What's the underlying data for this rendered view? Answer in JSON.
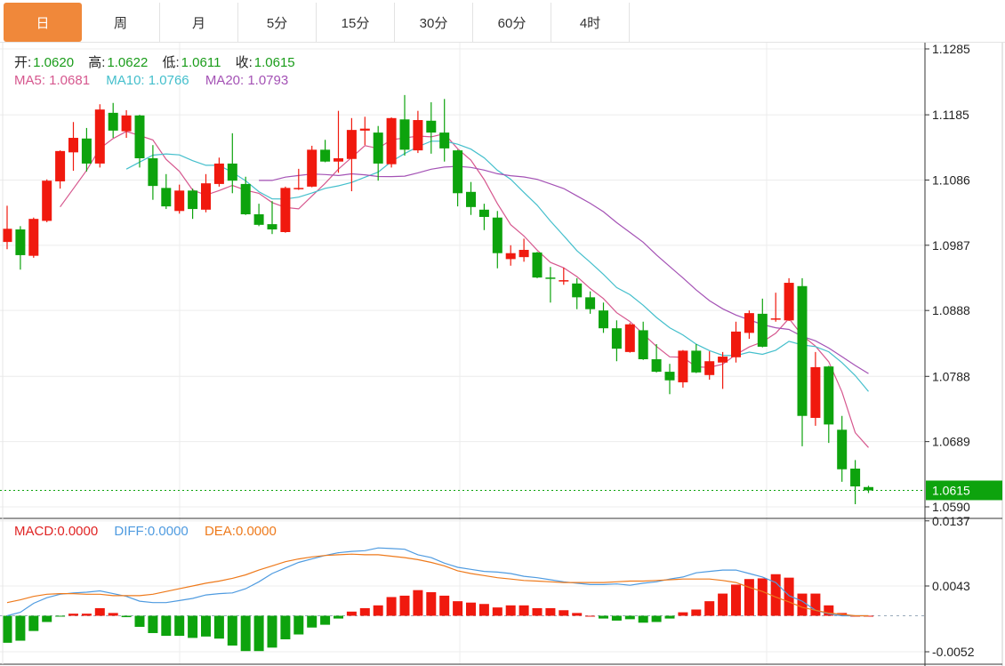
{
  "tabs": [
    {
      "label": "日",
      "active": true
    },
    {
      "label": "周"
    },
    {
      "label": "月"
    },
    {
      "label": "5分"
    },
    {
      "label": "15分"
    },
    {
      "label": "30分"
    },
    {
      "label": "60分"
    },
    {
      "label": "4时"
    }
  ],
  "ohlc_legend": {
    "open_label": "开:",
    "open": "1.0620",
    "high_label": "高:",
    "high": "1.0622",
    "low_label": "低:",
    "low": "1.0611",
    "close_label": "收:",
    "close": "1.0615"
  },
  "ma_legend": {
    "ma5": "MA5: 1.0681",
    "ma10": "MA10: 1.0766",
    "ma20": "MA20: 1.0793"
  },
  "macd_legend": {
    "macd": "MACD:0.0000",
    "diff": "DIFF:0.0000",
    "dea": "DEA:0.0000"
  },
  "colors": {
    "up": "#F0190E",
    "down": "#0DA30D",
    "ma5": "#D6578E",
    "ma10": "#44BFCC",
    "ma20": "#A452B5",
    "diff": "#4F9BE0",
    "dea": "#EE7A1C",
    "active_tab": "#F0883A",
    "price_tag": "#0DA30D"
  },
  "chart_data": [
    {
      "type": "candlestick",
      "price_axis_ticks": [
        "1.1285",
        "1.1185",
        "1.1086",
        "1.0987",
        "1.0888",
        "1.0788",
        "1.0689",
        "1.0590"
      ],
      "ylim": [
        1.059,
        1.1285
      ],
      "current_price": "1.0615",
      "moving_averages": [
        5,
        10,
        20
      ],
      "ohlc": [
        [
          1.0992,
          1.1047,
          1.0981,
          1.1012
        ],
        [
          1.1011,
          1.1016,
          1.095,
          1.0972
        ],
        [
          1.0971,
          1.1029,
          1.0968,
          1.1027
        ],
        [
          1.1024,
          1.1087,
          1.1022,
          1.1085
        ],
        [
          1.1084,
          1.1131,
          1.1073,
          1.113
        ],
        [
          1.1128,
          1.1174,
          1.11,
          1.115
        ],
        [
          1.1149,
          1.1165,
          1.1099,
          1.1111
        ],
        [
          1.1111,
          1.1201,
          1.1105,
          1.1193
        ],
        [
          1.1188,
          1.1203,
          1.115,
          1.1161
        ],
        [
          1.116,
          1.1192,
          1.115,
          1.1184
        ],
        [
          1.1184,
          1.1185,
          1.1105,
          1.1119
        ],
        [
          1.1119,
          1.1139,
          1.1056,
          1.1077
        ],
        [
          1.1074,
          1.1095,
          1.1042,
          1.1046
        ],
        [
          1.1039,
          1.1079,
          1.1035,
          1.107
        ],
        [
          1.107,
          1.1073,
          1.1027,
          1.1042
        ],
        [
          1.1041,
          1.1095,
          1.1037,
          1.1081
        ],
        [
          1.108,
          1.112,
          1.1076,
          1.1111
        ],
        [
          1.1111,
          1.1157,
          1.1066,
          1.1085
        ],
        [
          1.108,
          1.1091,
          1.1033,
          1.1034
        ],
        [
          1.1034,
          1.105,
          1.1016,
          1.1018
        ],
        [
          1.1019,
          1.1054,
          1.1004,
          1.1011
        ],
        [
          1.1007,
          1.1076,
          1.1006,
          1.1074
        ],
        [
          1.1072,
          1.1103,
          1.1071,
          1.1074
        ],
        [
          1.1076,
          1.1138,
          1.1075,
          1.1132
        ],
        [
          1.1132,
          1.1147,
          1.1113,
          1.1114
        ],
        [
          1.1114,
          1.1191,
          1.1097,
          1.1119
        ],
        [
          1.1118,
          1.118,
          1.1069,
          1.1162
        ],
        [
          1.1161,
          1.1182,
          1.1139,
          1.1164
        ],
        [
          1.1158,
          1.1168,
          1.1085,
          1.1111
        ],
        [
          1.111,
          1.1181,
          1.1105,
          1.118
        ],
        [
          1.1178,
          1.1215,
          1.1123,
          1.1132
        ],
        [
          1.1131,
          1.1191,
          1.1127,
          1.1177
        ],
        [
          1.1176,
          1.1204,
          1.1126,
          1.1158
        ],
        [
          1.1158,
          1.1209,
          1.1114,
          1.1134
        ],
        [
          1.1131,
          1.1132,
          1.1046,
          1.1066
        ],
        [
          1.1068,
          1.1083,
          1.1033,
          1.1045
        ],
        [
          1.1041,
          1.105,
          1.101,
          1.103
        ],
        [
          1.1029,
          1.1039,
          1.0952,
          1.0975
        ],
        [
          1.0966,
          1.0987,
          1.0956,
          1.0975
        ],
        [
          1.0969,
          1.0997,
          1.0962,
          1.098
        ],
        [
          1.0976,
          1.0977,
          1.0937,
          1.0938
        ],
        [
          1.0938,
          1.0954,
          1.09,
          1.0937
        ],
        [
          1.0933,
          1.0953,
          1.0927,
          1.0934
        ],
        [
          1.0929,
          1.0937,
          1.089,
          1.0908
        ],
        [
          1.0908,
          1.0917,
          1.0883,
          1.089
        ],
        [
          1.0888,
          1.09,
          1.0854,
          1.0861
        ],
        [
          1.0861,
          1.0873,
          1.0811,
          1.083
        ],
        [
          1.0825,
          1.0869,
          1.0824,
          1.0867
        ],
        [
          1.0858,
          1.0871,
          1.0813,
          1.0814
        ],
        [
          1.0814,
          1.0837,
          1.0794,
          1.0795
        ],
        [
          1.0795,
          1.0807,
          1.0761,
          1.0782
        ],
        [
          1.0779,
          1.0828,
          1.0771,
          1.0827
        ],
        [
          1.0827,
          1.0837,
          1.0793,
          1.0794
        ],
        [
          1.079,
          1.0826,
          1.0783,
          1.0811
        ],
        [
          1.0809,
          1.0825,
          1.0769,
          1.0818
        ],
        [
          1.0817,
          1.0871,
          1.0809,
          1.0856
        ],
        [
          1.0854,
          1.0888,
          1.0845,
          1.0884
        ],
        [
          1.0883,
          1.0906,
          1.0832,
          1.0833
        ],
        [
          1.0875,
          1.0915,
          1.0871,
          1.0876
        ],
        [
          1.0873,
          1.0937,
          1.0872,
          1.093
        ],
        [
          1.0925,
          1.0937,
          1.0682,
          1.0728
        ],
        [
          1.0725,
          1.0825,
          1.0713,
          1.0802
        ],
        [
          1.0803,
          1.0804,
          1.0687,
          1.0715
        ],
        [
          1.0707,
          1.0728,
          1.0628,
          1.0647
        ],
        [
          1.0648,
          1.0661,
          1.0594,
          1.0621
        ],
        [
          1.062,
          1.0622,
          1.0611,
          1.0615
        ]
      ]
    },
    {
      "type": "bar+line",
      "axis_ticks": [
        "0.0137",
        "0.0043",
        "-0.0052"
      ],
      "ylim": [
        -0.0052,
        0.0137
      ],
      "macd_hist": [
        -0.0039,
        -0.0036,
        -0.0022,
        -0.0009,
        -0.0001,
        0.0003,
        0.0003,
        0.0011,
        0.0004,
        -0.0002,
        -0.0016,
        -0.0025,
        -0.0029,
        -0.0029,
        -0.0032,
        -0.003,
        -0.0033,
        -0.0043,
        -0.0051,
        -0.0051,
        -0.0046,
        -0.0034,
        -0.0027,
        -0.0017,
        -0.0013,
        -0.0004,
        0.0006,
        0.0011,
        0.0015,
        0.0027,
        0.0029,
        0.0037,
        0.0034,
        0.0029,
        0.0021,
        0.0019,
        0.0017,
        0.0012,
        0.0015,
        0.0015,
        0.0011,
        0.0011,
        0.0008,
        0.0004,
        0.0,
        -0.0004,
        -0.0007,
        -0.0005,
        -0.001,
        -0.0009,
        -0.0004,
        0.0005,
        0.0009,
        0.0021,
        0.0032,
        0.0045,
        0.0053,
        0.0054,
        0.006,
        0.0055,
        0.0032,
        0.0032,
        0.0015,
        0.0004,
        0.0,
        0.0
      ],
      "diff": [
        0.0,
        0.0005,
        0.0018,
        0.0026,
        0.0031,
        0.0033,
        0.0034,
        0.0036,
        0.0032,
        0.0028,
        0.0021,
        0.0019,
        0.0019,
        0.0022,
        0.0025,
        0.003,
        0.0032,
        0.0033,
        0.0039,
        0.0049,
        0.0061,
        0.0069,
        0.0077,
        0.0082,
        0.0087,
        0.0091,
        0.0093,
        0.0094,
        0.0098,
        0.0097,
        0.0096,
        0.0088,
        0.0084,
        0.0076,
        0.007,
        0.0067,
        0.0064,
        0.0063,
        0.0061,
        0.0057,
        0.0055,
        0.0052,
        0.0049,
        0.0047,
        0.0045,
        0.0045,
        0.0046,
        0.0044,
        0.0047,
        0.0049,
        0.0053,
        0.0056,
        0.0062,
        0.0064,
        0.0066,
        0.0066,
        0.0061,
        0.0056,
        0.0048,
        0.0029,
        0.0021,
        0.0008,
        0.0003,
        0.0,
        0.0,
        0.0
      ],
      "dea": [
        0.0019,
        0.0023,
        0.0028,
        0.0031,
        0.0032,
        0.0032,
        0.0031,
        0.0031,
        0.0029,
        0.0029,
        0.0029,
        0.0031,
        0.0035,
        0.0039,
        0.0043,
        0.0047,
        0.005,
        0.0054,
        0.0059,
        0.0066,
        0.0072,
        0.0078,
        0.0082,
        0.0085,
        0.0087,
        0.0088,
        0.0089,
        0.0088,
        0.0088,
        0.0086,
        0.0084,
        0.0081,
        0.0077,
        0.0072,
        0.0065,
        0.0061,
        0.0058,
        0.0055,
        0.0053,
        0.0051,
        0.005,
        0.0049,
        0.0048,
        0.0048,
        0.0048,
        0.0048,
        0.0049,
        0.005,
        0.005,
        0.0051,
        0.0052,
        0.0053,
        0.0053,
        0.0053,
        0.0051,
        0.0048,
        0.0041,
        0.0035,
        0.0027,
        0.002,
        0.0012,
        0.0008,
        0.0004,
        0.0002,
        0.0,
        0.0
      ]
    }
  ]
}
